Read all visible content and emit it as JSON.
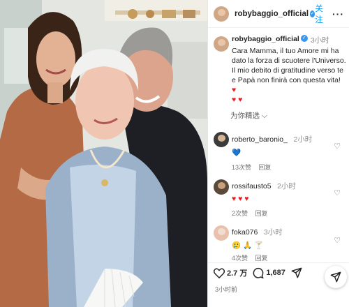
{
  "header": {
    "username": "robybaggio_official",
    "follow_label": "关注",
    "more_label": "···"
  },
  "caption": {
    "username": "robybaggio_official",
    "time": "3小时",
    "text": "Cara Mamma, il tuo Amore mi ha dato la forza di scuotere l'Universo. Il mio debito di gratitudine verso te e Papà non finirà con questa vita!",
    "hearts": "♥ ♥",
    "trailing_heart": "♥",
    "see_translation": "为你精选 ⌵"
  },
  "comments": [
    {
      "username": "roberto_baronio_",
      "time": "2小时",
      "text": "💙",
      "likes": "13次赞",
      "reply": "回复"
    },
    {
      "username": "rossifausto5",
      "time": "2小时",
      "text": "♥ ♥ ♥",
      "likes": "2次赞",
      "reply": "回复"
    },
    {
      "username": "foka076",
      "time": "3小时",
      "text": "🥲 🙏 🍸",
      "likes": "4次赞",
      "reply": "回复"
    }
  ],
  "actions": {
    "likes_count": "2.7 万",
    "comments_count": "1,687",
    "posted_time": "3小时前"
  },
  "icons": {
    "verified": "verified-badge-icon",
    "like": "heart-outline-icon",
    "comment": "comment-bubble-icon",
    "share": "paper-plane-icon"
  },
  "colors": {
    "link_blue": "#0095f6",
    "verified_blue": "#3897f0",
    "heart_red": "#ed1c24",
    "meta_gray": "#737373"
  }
}
